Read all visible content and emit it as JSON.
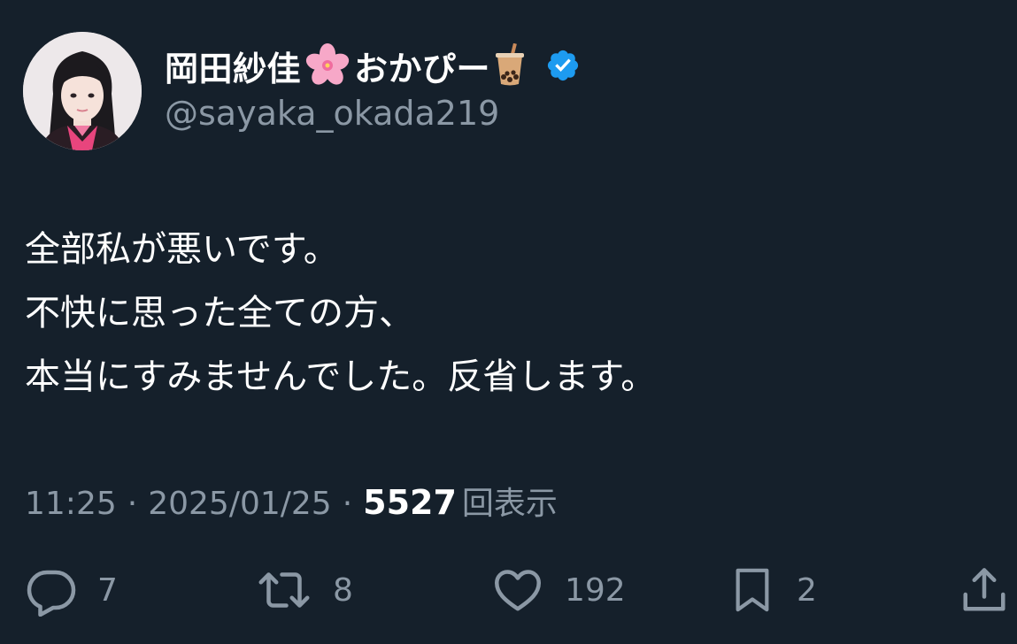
{
  "author": {
    "display_name": "岡田紗佳",
    "display_name_suffix": "おかぴー",
    "name_emoji_1": "cherry-blossom-emoji",
    "name_emoji_2": "bubble-tea-emoji",
    "handle": "@sayaka_okada219",
    "verified_color": "#1d9bf0"
  },
  "tweet": {
    "lines": [
      "全部私が悪いです。",
      "不快に思った全ての方、",
      "本当にすみませんでした。反省します。"
    ]
  },
  "meta": {
    "time": "11:25",
    "separator": "·",
    "date": "2025/01/25",
    "views_count": "5527",
    "views_label": "回表示"
  },
  "actions": {
    "reply_count": "7",
    "retweet_count": "8",
    "like_count": "192",
    "bookmark_count": "2"
  },
  "colors": {
    "background": "#15202b",
    "secondary_text": "#8b98a5",
    "primary_text": "#ffffff"
  }
}
